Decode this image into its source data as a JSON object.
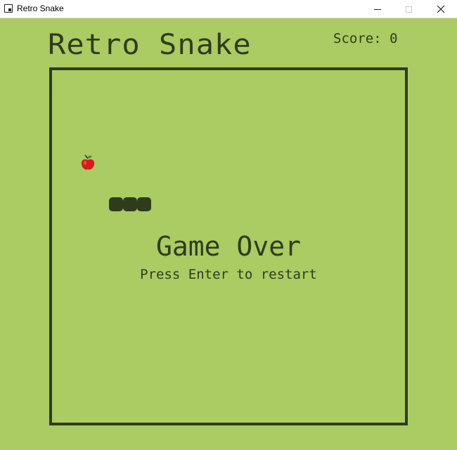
{
  "window": {
    "title": "Retro Snake",
    "icon": "app-window-icon",
    "controls": [
      "minimize",
      "maximize",
      "close"
    ]
  },
  "game": {
    "title": "Retro Snake",
    "score_label": "Score: 0",
    "status": "Game Over",
    "hint": "Press Enter to restart",
    "apple_icon": "apple-icon",
    "snake_length": 3
  },
  "colors": {
    "background": "#abcb63",
    "foreground": "#2e3c1c",
    "apple": "#d91a1a"
  }
}
